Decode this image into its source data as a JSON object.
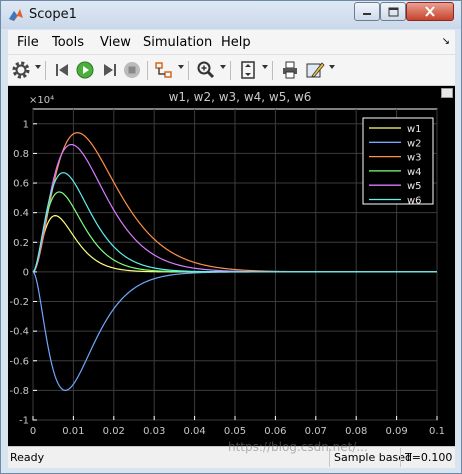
{
  "window": {
    "title": "Scope1"
  },
  "menu": [
    "File",
    "Tools",
    "View",
    "Simulation",
    "Help"
  ],
  "toolbar_icons": [
    "gear-icon",
    "step-back-icon",
    "run-icon",
    "step-forward-icon",
    "stop-icon",
    "highlight-signal-icon",
    "zoom-icon",
    "fit-axes-icon",
    "print-icon",
    "style-icon"
  ],
  "status": {
    "ready": "Ready",
    "sample_based": "Sample based",
    "time": "T=0.100"
  },
  "watermark": "https://blog.csdn.net/...",
  "colors": {
    "background": "#000000",
    "axes": "#ffffff",
    "grid": "#3c3c3c"
  },
  "chart_data": {
    "type": "line",
    "title": "w1, w2, w3, w4, w5, w6",
    "y_exponent": "×10⁴",
    "xlim": [
      0,
      0.1
    ],
    "ylim": [
      -1,
      1.1
    ],
    "x_ticks": [
      "0",
      "0.01",
      "0.02",
      "0.03",
      "0.04",
      "0.05",
      "0.06",
      "0.07",
      "0.08",
      "0.09",
      "0.1"
    ],
    "y_ticks": [
      "1",
      "0.8",
      "0.6",
      "0.4",
      "0.2",
      "0",
      "-0.2",
      "-0.4",
      "-0.6",
      "-0.8",
      "-1"
    ],
    "grid": true,
    "legend_position": "top-right",
    "series": [
      {
        "name": "w1",
        "color": "#ffff80",
        "peak": 0.38,
        "t_peak": 0.0055
      },
      {
        "name": "w2",
        "color": "#6ea8ff",
        "peak": -0.8,
        "t_peak": 0.008
      },
      {
        "name": "w3",
        "color": "#ff8f4a",
        "peak": 0.94,
        "t_peak": 0.011
      },
      {
        "name": "w4",
        "color": "#7fff7f",
        "peak": 0.54,
        "t_peak": 0.0065
      },
      {
        "name": "w5",
        "color": "#d77cff",
        "peak": 0.86,
        "t_peak": 0.0095
      },
      {
        "name": "w6",
        "color": "#5ff0ef",
        "peak": 0.67,
        "t_peak": 0.0075
      }
    ]
  }
}
